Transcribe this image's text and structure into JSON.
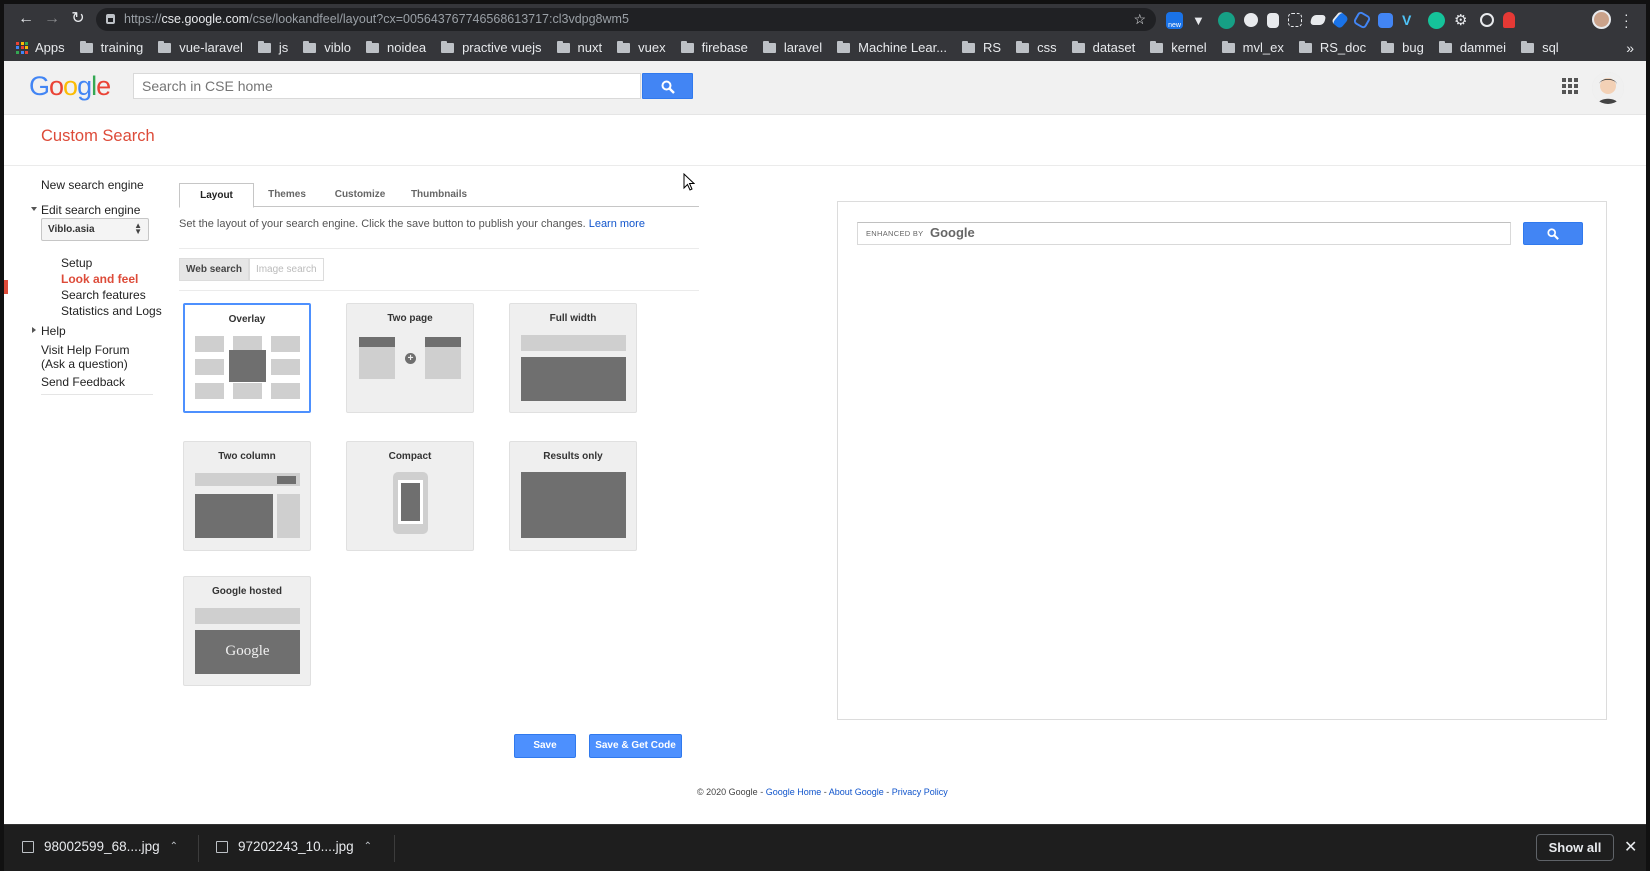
{
  "browser": {
    "url_prefix": "https://",
    "url_host": "cse.google.com",
    "url_path": "/cse/lookandfeel/layout?cx=005643767746568613717:cl3vdpg8wm5",
    "extension_badge": "new",
    "bookmarks": {
      "apps": "Apps",
      "items": [
        "training",
        "vue-laravel",
        "js",
        "viblo",
        "noidea",
        "practive vuejs",
        "nuxt",
        "vuex",
        "firebase",
        "laravel",
        "Machine Lear...",
        "RS",
        "css",
        "dataset",
        "kernel",
        "mvl_ex",
        "RS_doc",
        "bug",
        "dammei",
        "sql"
      ],
      "more": "»"
    }
  },
  "header": {
    "search_placeholder": "Search in CSE home",
    "logo_letters": [
      "G",
      "o",
      "o",
      "g",
      "l",
      "e"
    ],
    "logo_colors": [
      "#4285f4",
      "#ea4335",
      "#fbbc05",
      "#4285f4",
      "#34a853",
      "#ea4335"
    ]
  },
  "page_title": "Custom Search",
  "sidebar": {
    "new_engine": "New search engine",
    "edit_engine": "Edit search engine",
    "engine_select": "Viblo.asia",
    "setup": "Setup",
    "look_and_feel": "Look and feel",
    "search_features": "Search features",
    "statistics": "Statistics and Logs",
    "help": "Help",
    "forum_line1": "Visit Help Forum",
    "forum_line2": "(Ask a question)",
    "feedback": "Send Feedback"
  },
  "tabs": [
    "Layout",
    "Themes",
    "Customize",
    "Thumbnails"
  ],
  "description": "Set the layout of your search engine. Click the save button to publish your changes.",
  "learn_more": "Learn more",
  "search_types": {
    "web": "Web search",
    "image": "Image search"
  },
  "layouts": {
    "overlay": "Overlay",
    "two_page": "Two page",
    "full_width": "Full width",
    "two_column": "Two column",
    "compact": "Compact",
    "results_only": "Results only",
    "google_hosted": "Google hosted",
    "hosted_logo": "Google"
  },
  "selected_layout": "Overlay",
  "buttons": {
    "save": "Save",
    "save_code": "Save & Get Code"
  },
  "footer": {
    "copyright": "© 2020 Google",
    "sep1": " - ",
    "google_home": "Google Home",
    "sep2": " - ",
    "about": "About Google",
    "sep3": " - ",
    "privacy": "Privacy Policy"
  },
  "preview": {
    "enhanced_by": "ENHANCED BY",
    "google": "Google"
  },
  "downloads": {
    "file1": "98002599_68....jpg",
    "file2": "97202243_10....jpg",
    "show_all": "Show all"
  },
  "colors": {
    "accent_red": "#dd4b39",
    "button_blue": "#4d90fe",
    "link_blue": "#1155cc"
  }
}
